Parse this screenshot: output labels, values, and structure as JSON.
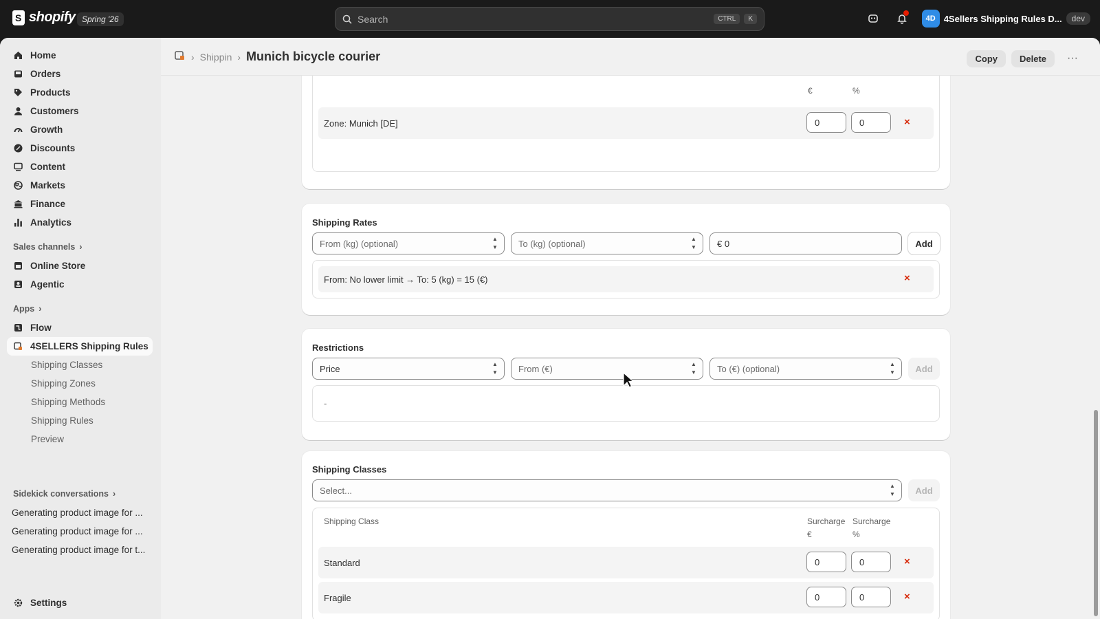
{
  "topbar": {
    "brand": "shopify",
    "edition": "Spring '26",
    "search_placeholder": "Search",
    "kbd_ctrl": "CTRL",
    "kbd_k": "K",
    "notification_count": "1",
    "store_initials": "4D",
    "store_name": "4Sellers Shipping Rules D...",
    "env_badge": "dev"
  },
  "sidebar": {
    "main": [
      {
        "label": "Home",
        "icon": "home-icon"
      },
      {
        "label": "Orders",
        "icon": "inbox-icon"
      },
      {
        "label": "Products",
        "icon": "tag-icon"
      },
      {
        "label": "Customers",
        "icon": "person-icon"
      },
      {
        "label": "Growth",
        "icon": "gauge-icon"
      },
      {
        "label": "Discounts",
        "icon": "discount-icon"
      },
      {
        "label": "Content",
        "icon": "content-icon"
      },
      {
        "label": "Markets",
        "icon": "globe-icon"
      },
      {
        "label": "Finance",
        "icon": "bank-icon"
      },
      {
        "label": "Analytics",
        "icon": "bar-chart-icon"
      }
    ],
    "sales_channels_label": "Sales channels",
    "sales_channels": [
      {
        "label": "Online Store",
        "icon": "store-icon"
      },
      {
        "label": "Agentic",
        "icon": "agent-icon"
      }
    ],
    "apps_label": "Apps",
    "apps": [
      {
        "label": "Flow",
        "icon": "flow-icon"
      },
      {
        "label": "4SELLERS Shipping Rules",
        "icon": "app-icon"
      }
    ],
    "app_sub": [
      "Shipping Classes",
      "Shipping Zones",
      "Shipping Methods",
      "Shipping Rules",
      "Preview"
    ],
    "sidekick_label": "Sidekick conversations",
    "conversations": [
      "Generating product image for ...",
      "Generating product image for ...",
      "Generating product image for t..."
    ],
    "settings_label": "Settings"
  },
  "header": {
    "crumb_parent": "Shippin",
    "title": "Munich bicycle courier",
    "copy_label": "Copy",
    "delete_label": "Delete",
    "more_label": "···"
  },
  "zones_card": {
    "col_surcharge_eur_unit": "€",
    "col_surcharge_pct_unit": "%",
    "row_label": "Zone: Munich [DE]",
    "eur": "0",
    "pct": "0",
    "remove": "×"
  },
  "rates_card": {
    "title": "Shipping Rates",
    "from_placeholder": "From (kg) (optional)",
    "to_placeholder": "To (kg) (optional)",
    "price_value": "€ 0",
    "add_label": "Add",
    "row_label": "From: No lower limit → To: 5 (kg) = 15 (€)",
    "remove": "×"
  },
  "restrictions_card": {
    "title": "Restrictions",
    "type_value": "Price",
    "from_placeholder": "From (€)",
    "to_placeholder": "To (€) (optional)",
    "add_label": "Add",
    "empty_text": "-"
  },
  "classes_card": {
    "title": "Shipping Classes",
    "select_placeholder": "Select...",
    "add_label": "Add",
    "col_class": "Shipping Class",
    "col_surcharge": "Surcharge",
    "col_eur_unit": "€",
    "col_pct_unit": "%",
    "rows": [
      {
        "label": "Standard",
        "eur": "0",
        "pct": "0"
      },
      {
        "label": "Fragile",
        "eur": "0",
        "pct": "0"
      }
    ],
    "remove": "×"
  }
}
